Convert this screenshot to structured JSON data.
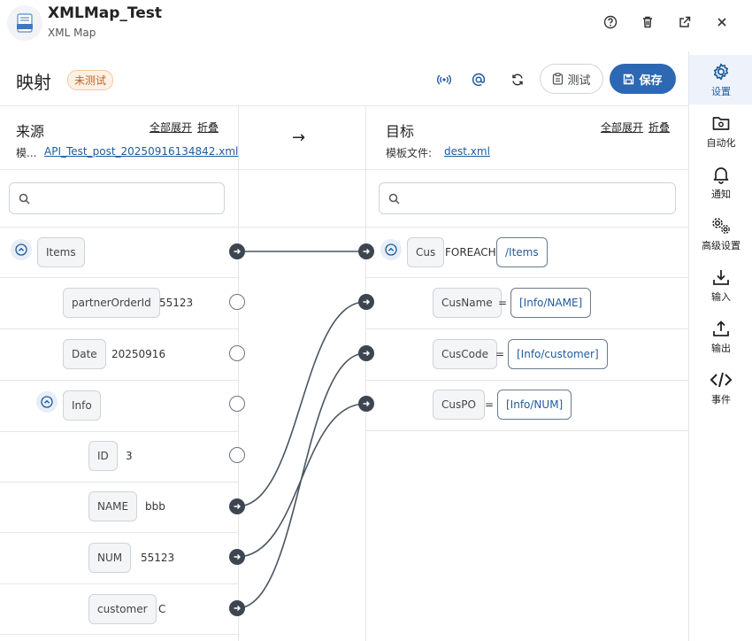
{
  "app": {
    "title": "XMLMap_Test",
    "subtitle": "XML Map",
    "icon_label": "XML"
  },
  "toolbar": {
    "title": "映射",
    "status_badge": "未测试",
    "test_label": "测试",
    "save_label": "保存"
  },
  "sidebar": {
    "items": [
      {
        "label": "设置",
        "icon": "gear-icon",
        "active": true
      },
      {
        "label": "自动化",
        "icon": "folder-gear-icon"
      },
      {
        "label": "通知",
        "icon": "bell-icon"
      },
      {
        "label": "高级设置",
        "icon": "gears-icon"
      },
      {
        "label": "输入",
        "icon": "download-icon"
      },
      {
        "label": "输出",
        "icon": "upload-icon"
      },
      {
        "label": "事件",
        "icon": "code-icon"
      }
    ]
  },
  "source": {
    "title": "来源",
    "expand_all": "全部展开",
    "collapse": "折叠",
    "template_label": "模...",
    "template_file": "API_Test_post_20250916134842.xml",
    "search_placeholder": "",
    "nodes": [
      {
        "name": "Items",
        "value": ""
      },
      {
        "name": "partnerOrderId",
        "value": "55123"
      },
      {
        "name": "Date",
        "value": "20250916"
      },
      {
        "name": "Info",
        "value": ""
      },
      {
        "name": "ID",
        "value": "3"
      },
      {
        "name": "NAME",
        "value": "bbb"
      },
      {
        "name": "NUM",
        "value": "55123"
      },
      {
        "name": "customer",
        "value": "C"
      }
    ]
  },
  "target": {
    "title": "目标",
    "expand_all": "全部展开",
    "collapse": "折叠",
    "template_label": "模板文件:",
    "template_file": "dest.xml",
    "search_placeholder": "",
    "nodes": [
      {
        "name": "Cus",
        "op": "FOREACH",
        "mapping": "/Items"
      },
      {
        "name": "CusName",
        "op": "=",
        "mapping": "[Info/NAME]"
      },
      {
        "name": "CusCode",
        "op": "=",
        "mapping": "[Info/customer]"
      },
      {
        "name": "CusPO",
        "op": "=",
        "mapping": "[Info/NUM]"
      }
    ]
  },
  "mappings": [
    {
      "from": "Items",
      "to": "Cus"
    },
    {
      "from": "NAME",
      "to": "CusName"
    },
    {
      "from": "customer",
      "to": "CusCode"
    },
    {
      "from": "NUM",
      "to": "CusPO"
    }
  ],
  "arrow": "→",
  "colors": {
    "accent": "#2c68b3",
    "link": "#1f5b9c",
    "connector": "#4a5560",
    "badge": "#b9662a"
  }
}
